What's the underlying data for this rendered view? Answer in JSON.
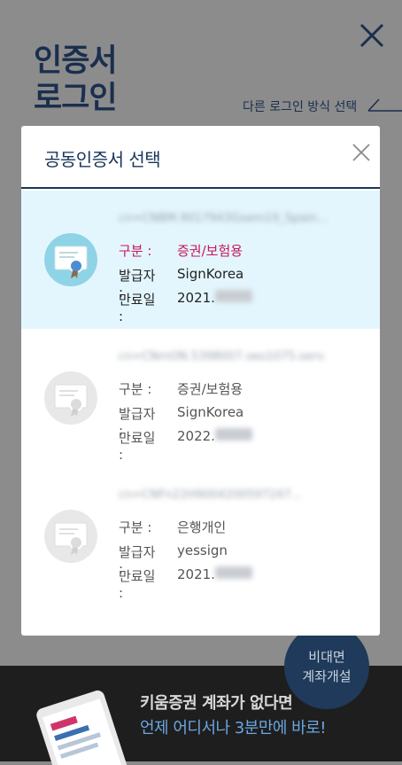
{
  "background": {
    "title": "인증서\n로그인",
    "other_login": "다른 로그인 방식 선택"
  },
  "modal": {
    "title": "공동인증서 선택",
    "certificates": [
      {
        "name_masked": "cn=CNBM.9017943Gsem19_Spain...",
        "kind_label": "구분 :",
        "kind_value": "증권/보험용",
        "issuer_label": "발급자 :",
        "issuer_value": "SignKorea",
        "expiry_label": "만료일 :",
        "expiry_value": "2021.",
        "selected": true
      },
      {
        "name_masked": "cn=CNmON.5398007.seo1075.serv...",
        "kind_label": "구분 :",
        "kind_value": "증권/보험용",
        "issuer_label": "발급자 :",
        "issuer_value": "SignKorea",
        "expiry_label": "만료일 :",
        "expiry_value": "2022.",
        "selected": false
      },
      {
        "name_masked": "cn=CNFn22H9004200597247...",
        "kind_label": "구분 :",
        "kind_value": "은행개인",
        "issuer_label": "발급자 :",
        "issuer_value": "yessign",
        "expiry_label": "만료일 :",
        "expiry_value": "2021.",
        "selected": false
      }
    ]
  },
  "banner": {
    "line1": "키움증권 계좌가 없다면",
    "line2": "언제 어디서나 3분만에 바로!"
  },
  "fab": {
    "label": "비대면\n계좌개설"
  },
  "colors": {
    "navy": "#17345a",
    "selected_bg": "#e4f6fd",
    "kind_selected": "#c2185b",
    "link_blue": "#6aa7e0"
  }
}
